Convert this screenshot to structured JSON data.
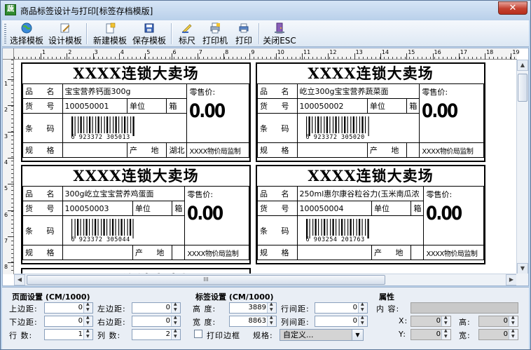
{
  "window": {
    "title": "商品标签设计与打印[标签存档模版]",
    "app_icon_text": "蔬",
    "close_label": "✕"
  },
  "toolbar": {
    "items": [
      {
        "label": "选择模板",
        "icon": "globe-icon"
      },
      {
        "label": "设计模板",
        "icon": "design-icon"
      },
      {
        "label": "新建模板",
        "icon": "new-template-icon"
      },
      {
        "label": "保存模板",
        "icon": "save-icon"
      },
      {
        "label": "标尺",
        "icon": "ruler-icon"
      },
      {
        "label": "打印机",
        "icon": "printer-setup-icon"
      },
      {
        "label": "打印",
        "icon": "print-icon"
      },
      {
        "label": "关闭ESC",
        "icon": "close-door-icon"
      }
    ]
  },
  "rulers": {
    "h_numbers": [
      "1",
      "2",
      "3",
      "4",
      "5",
      "6",
      "7",
      "8",
      "9",
      "10",
      "11",
      "12",
      "13",
      "14",
      "15",
      "16",
      "17",
      "18",
      "19"
    ],
    "v_numbers": [
      "1",
      "2",
      "3",
      "4",
      "5",
      "6",
      "7",
      "8"
    ]
  },
  "labels": [
    {
      "store": "XXXX连锁大卖场",
      "name_key": "品 名",
      "name": "宝宝营养钙面300g",
      "code_key": "货 号",
      "code": "100050001",
      "unit_key": "单位",
      "unit": "箱",
      "barcode_key": "条 码",
      "barcode_num": "6 923372 305013",
      "spec_key": "规 格",
      "spec": "",
      "origin_key": "产 地",
      "origin": "湖北",
      "price_label": "零售价:",
      "price": "0.00",
      "watch": "XXXX物价局监制"
    },
    {
      "store": "XXXX连锁大卖场",
      "name_key": "品 名",
      "name": "屹立300g宝宝营养蔬菜面",
      "code_key": "货 号",
      "code": "100050002",
      "unit_key": "单位",
      "unit": "箱",
      "barcode_key": "条 码",
      "barcode_num": "6 923372 305020",
      "spec_key": "规 格",
      "spec": "",
      "origin_key": "产 地",
      "origin": "",
      "price_label": "零售价:",
      "price": "0.00",
      "watch": "XXXX物价局监制"
    },
    {
      "store": "XXXX连锁大卖场",
      "name_key": "品 名",
      "name": "300g屹立宝宝营养鸡蛋面",
      "code_key": "货 号",
      "code": "100050003",
      "unit_key": "单位",
      "unit": "箱",
      "barcode_key": "条 码",
      "barcode_num": "6 923372 305044",
      "spec_key": "规 格",
      "spec": "",
      "origin_key": "产 地",
      "origin": "",
      "price_label": "零售价:",
      "price": "0.00",
      "watch": "XXXX物价局监制"
    },
    {
      "store": "XXXX连锁大卖场",
      "name_key": "品 名",
      "name": "250ml惠尔康谷粒谷力(玉米南瓜浓",
      "code_key": "货 号",
      "code": "100050004",
      "unit_key": "单位",
      "unit": "箱",
      "barcode_key": "条 码",
      "barcode_num": "6 903254 201763",
      "spec_key": "规 格",
      "spec": "",
      "origin_key": "产 地",
      "origin": "",
      "price_label": "零售价:",
      "price": "0.00",
      "watch": "XXXX物价局监制"
    }
  ],
  "partial_label": {
    "store": "XXXX连锁大卖场"
  },
  "hscroll_grip": "III",
  "page_settings": {
    "title": "页面设置 (CM/1000)",
    "top_margin_label": "上边距:",
    "top_margin": "0",
    "left_margin_label": "左边距:",
    "left_margin": "0",
    "bottom_margin_label": "下边距:",
    "bottom_margin": "0",
    "right_margin_label": "右边距:",
    "right_margin": "0",
    "rows_label": "行  数:",
    "rows": "1",
    "cols_label": "列  数:",
    "cols": "2"
  },
  "label_settings": {
    "title": "标签设置 (CM/1000)",
    "height_label": "高  度:",
    "height": "3889",
    "row_gap_label": "行间距:",
    "row_gap": "0",
    "width_label": "宽  度:",
    "width": "8863",
    "col_gap_label": "列间距:",
    "col_gap": "0",
    "print_border_label": "打印边框",
    "spec_label": "规格:",
    "spec_value": "自定义..."
  },
  "properties": {
    "title": "属性",
    "content_label": "内  容:",
    "x_label": "X:",
    "x": "0",
    "h_label": "高:",
    "h": "0",
    "y_label": "Y:",
    "y": "0",
    "w_label": "宽:",
    "w": "0"
  }
}
